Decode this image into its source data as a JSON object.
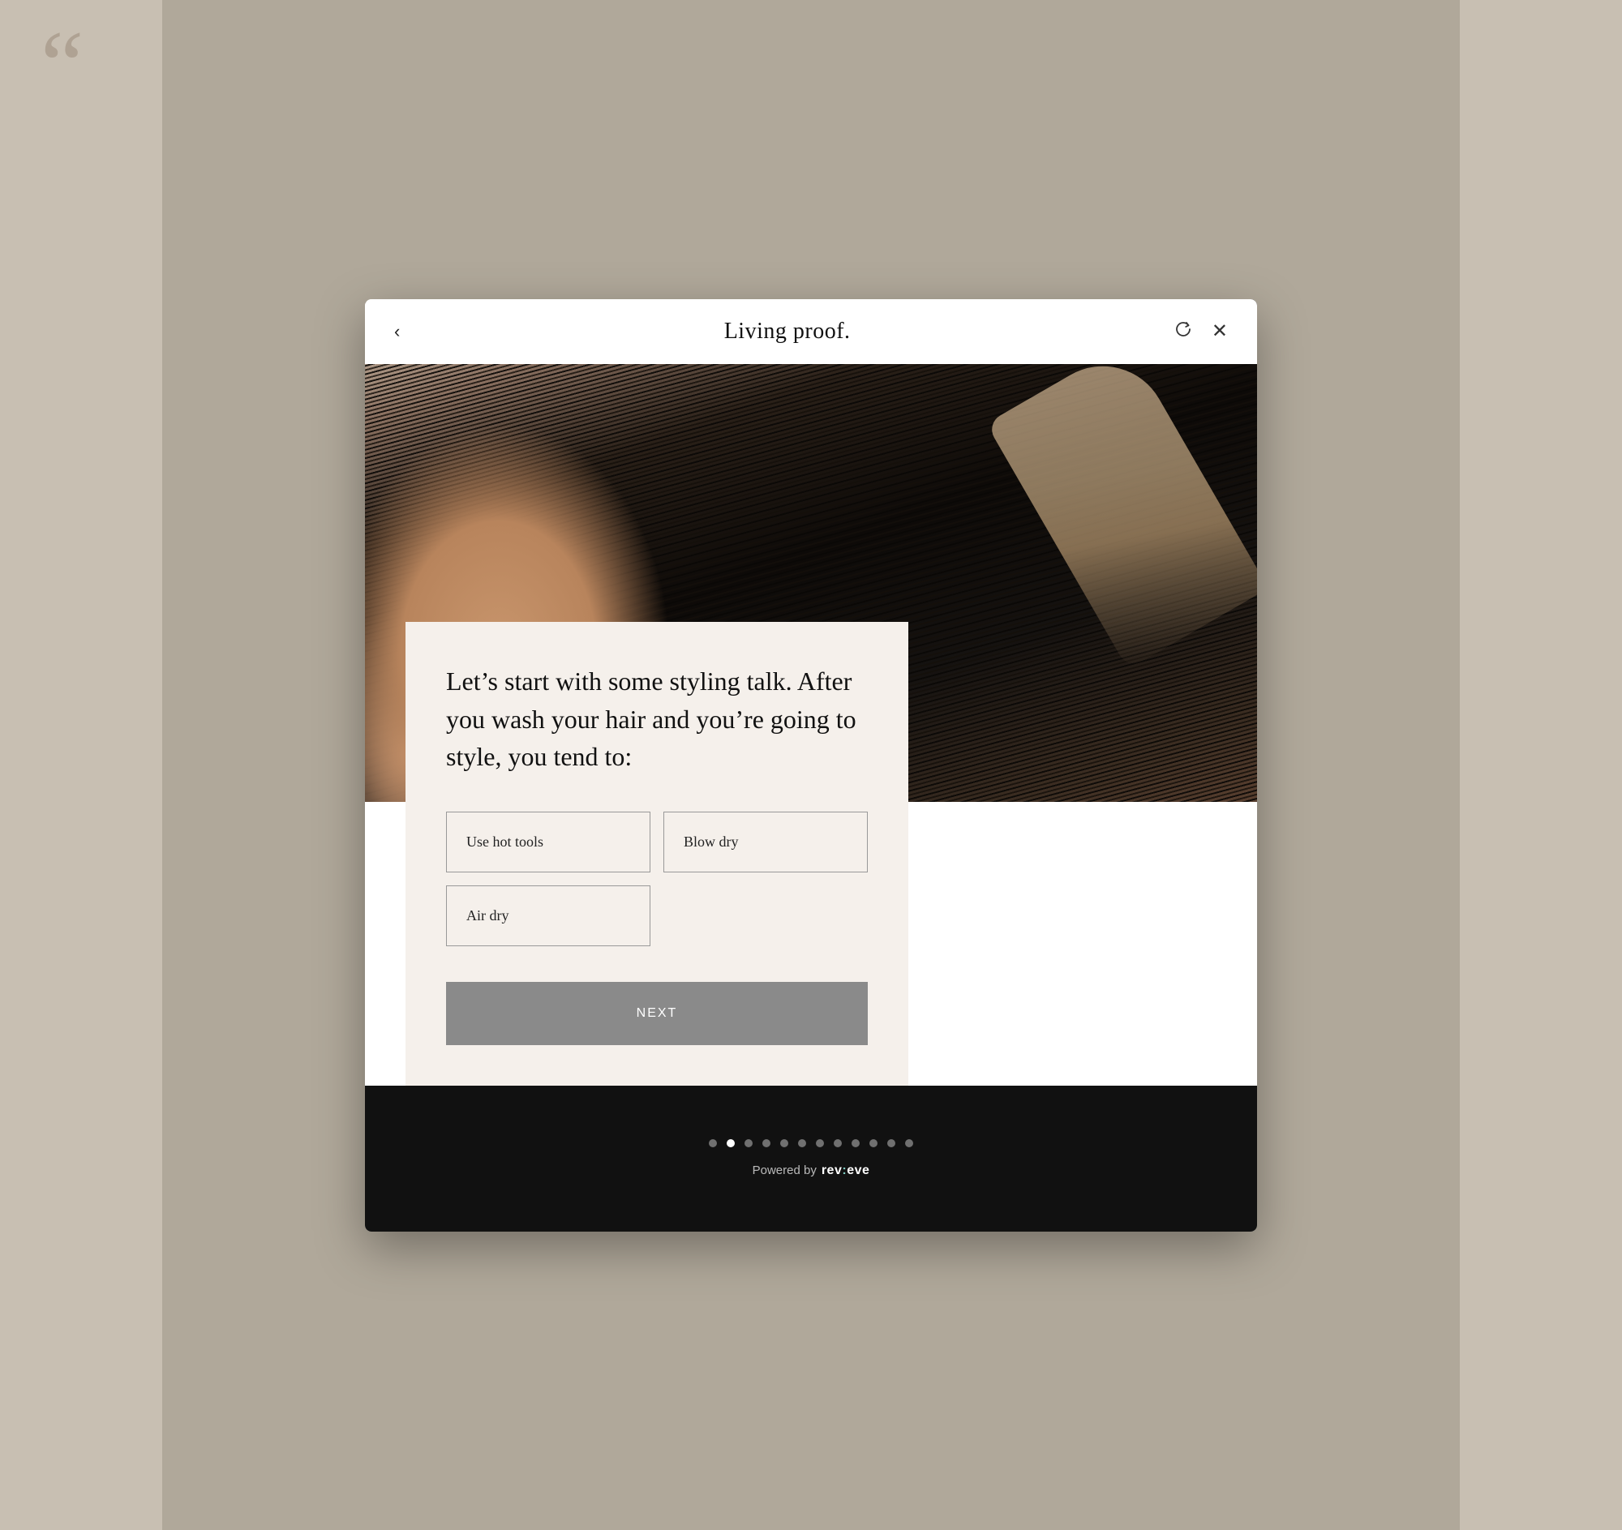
{
  "background": {
    "color": "#b0a89a",
    "quote_mark": "“"
  },
  "modal": {
    "header": {
      "back_icon": "‹",
      "title": "Living proof.",
      "refresh_icon": "↺",
      "close_icon": "✕"
    },
    "question": "Let’s start with some styling talk. After you wash your hair and you’re going to style, you tend to:",
    "options": [
      {
        "label": "Use hot tools",
        "id": "use-hot-tools"
      },
      {
        "label": "Blow dry",
        "id": "blow-dry"
      },
      {
        "label": "Air dry",
        "id": "air-dry"
      }
    ],
    "next_button_label": "NEXT",
    "footer": {
      "powered_by_label": "Powered by",
      "brand_name": "rev",
      "brand_colon": ":",
      "brand_suffix": "eve",
      "total_dots": 12,
      "active_dot_index": 1
    }
  }
}
